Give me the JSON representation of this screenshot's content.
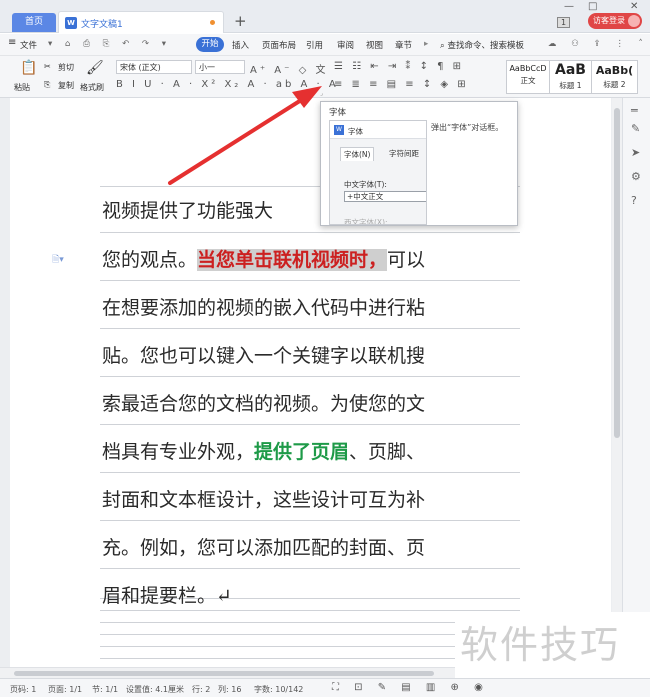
{
  "tabs": {
    "home": "首页",
    "document": "文字文稿1",
    "new_tab": "+"
  },
  "topright": {
    "badge": "1",
    "login": "访客登录",
    "minimize": "—",
    "maximize": "□",
    "close": "✕"
  },
  "menubar": {
    "file": "文件",
    "items": [
      "开始",
      "插入",
      "页面布局",
      "引用",
      "审阅",
      "视图",
      "章节"
    ],
    "search": "查找命令、搜索模板"
  },
  "ribbon": {
    "paste": "粘贴",
    "cut": "剪切",
    "copy": "复制",
    "format_painter": "格式刷",
    "font_name": "宋体 (正文)",
    "font_size": "小一",
    "styles": [
      {
        "preview": "AaBbCcD",
        "name": "正文"
      },
      {
        "preview": "AaB",
        "name": "标题 1"
      },
      {
        "preview": "AaBb(",
        "name": "标题 2"
      }
    ]
  },
  "document": {
    "line1": "视频提供了功能强大",
    "line2_pre": "您的观点。",
    "line2_red": "当您单击联机视频时，",
    "line2_post": "可以",
    "line3": "在想要添加的视频的嵌入代码中进行粘",
    "line4": "贴。您也可以键入一个关键字以联机搜",
    "line5": "索最适合您的文档的视频。为使您的文",
    "line6_pre": "档具有专业外观，",
    "line6_green": "提供了页眉",
    "line6_post": "、页脚、",
    "line7": "封面和文本框设计，这些设计可互为补",
    "line8": "充。例如，您可以添加匹配的封面、页",
    "line9": "眉和提要栏。↵"
  },
  "tooltip": {
    "title": "字体",
    "description": "弹出“字体”对话框。",
    "mini_title": "字体",
    "tab_font": "字体(N)",
    "tab_spacing": "字符间距",
    "cn_font_label": "中文字体(T):",
    "cn_font_value": "+中文正文",
    "en_font_label": "西文字体(X):"
  },
  "statusbar": {
    "page_num": "页码: 1",
    "pages": "页面: 1/1",
    "section": "节: 1/1",
    "setting": "设置值: 4.1厘米",
    "row": "行: 2",
    "col": "列: 16",
    "words": "字数: 10/142"
  },
  "watermark": "软件技巧",
  "colors": {
    "accent": "#3a71d6",
    "highlight_red": "#cc2020",
    "highlight_green": "#1e9a48",
    "arrow": "#e53030"
  }
}
